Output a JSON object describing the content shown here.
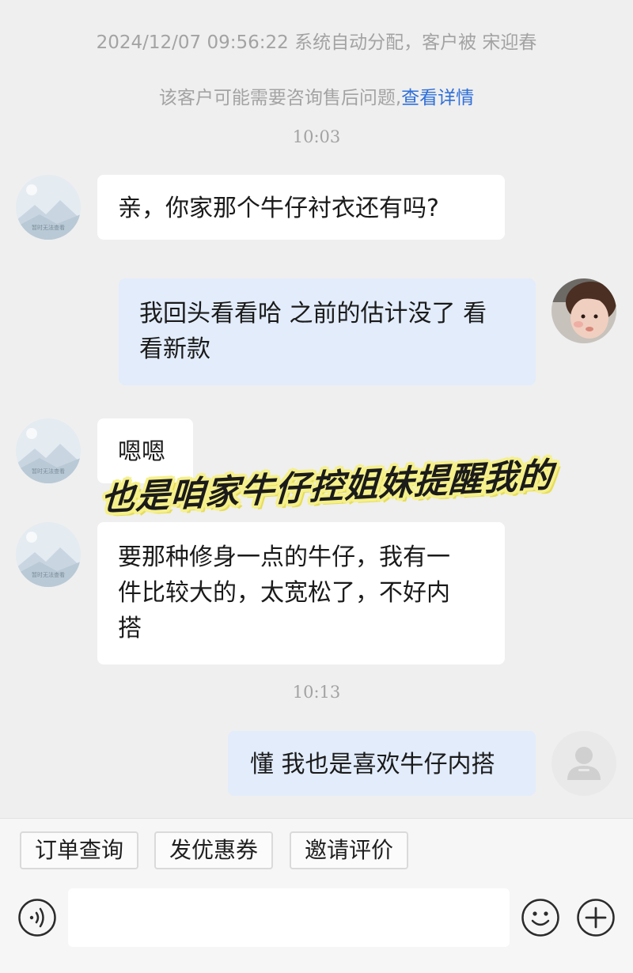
{
  "system": {
    "assign_text": "2024/12/07 09:56:22 系统自动分配，客户被 宋迎春",
    "hint_text": "该客户可能需要咨询售后问题,",
    "hint_link": "查看详情"
  },
  "placeholder_avatar_label": "暂时无法查看",
  "messages": [
    {
      "time": "10:03"
    },
    {
      "from": "customer",
      "text": "亲，你家那个牛仔衬衣还有吗?"
    },
    {
      "from": "agent",
      "line1": "我回头看看哈 之前的估计没了 看",
      "line2": "看新款"
    },
    {
      "from": "customer",
      "text": "嗯嗯"
    },
    {
      "from": "customer",
      "line1": "要那种修身一点的牛仔，我有一",
      "line2": "件比较大的，太宽松了，不好内",
      "line3": "搭"
    },
    {
      "time": "10:13"
    },
    {
      "from": "agent",
      "text": "懂 我也是喜欢牛仔内搭"
    }
  ],
  "overlay_caption": "也是咱家牛仔控姐妹提醒我的",
  "quick_actions": [
    "订单查询",
    "发优惠券",
    "邀请评价"
  ],
  "input": {
    "value": "",
    "placeholder": ""
  },
  "icons": {
    "voice": "voice-icon",
    "emoji": "emoji-icon",
    "more": "plus-icon"
  },
  "colors": {
    "background": "#efefef",
    "incoming_bubble": "#ffffff",
    "outgoing_bubble": "#e2ecfb",
    "link": "#2f6fd8",
    "caption_highlight": "#f5f08a"
  }
}
